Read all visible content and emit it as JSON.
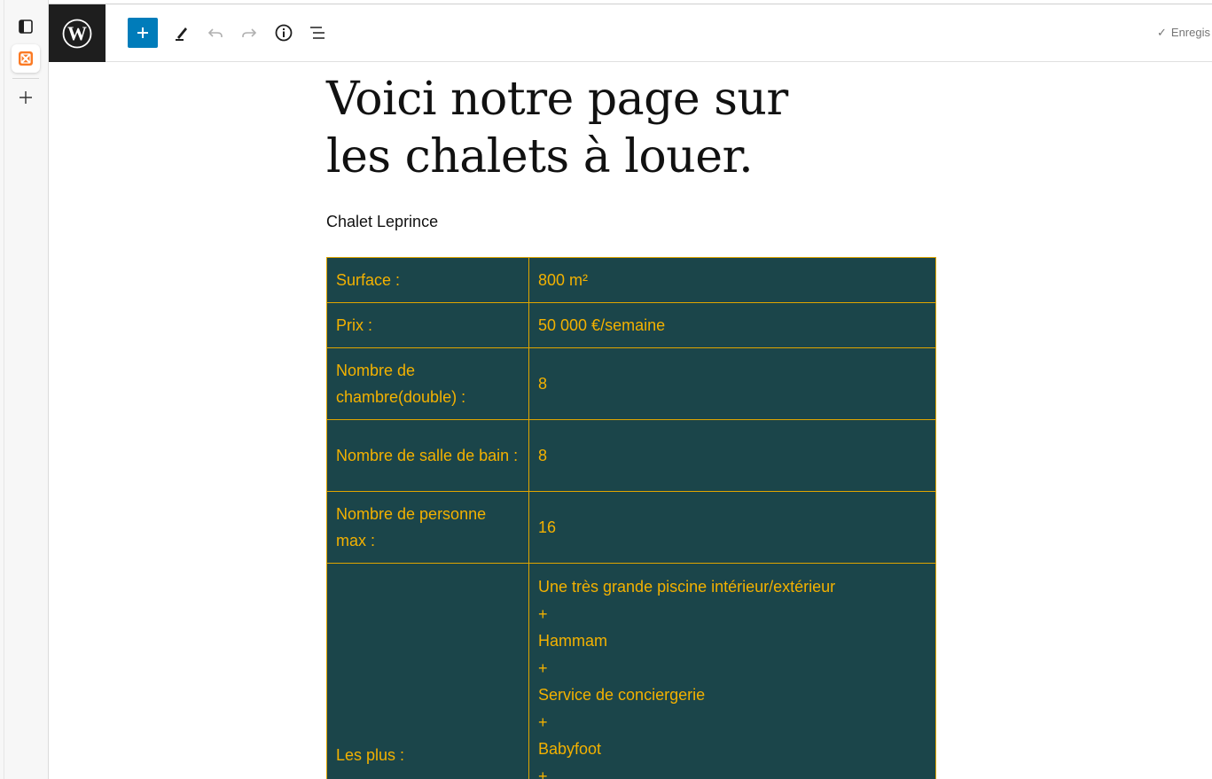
{
  "rail": {
    "icons": [
      "sidebar-toggle-icon",
      "xampp-icon",
      "plus-icon"
    ]
  },
  "toolbar": {
    "logo": "wordpress-logo",
    "tools": [
      "add-block-icon",
      "edit-pen-icon",
      "undo-icon",
      "redo-icon",
      "info-icon",
      "list-view-icon"
    ],
    "status_label": "Enregis"
  },
  "page": {
    "title": "Voici notre page sur les chalets à louer.",
    "subtitle": "Chalet Leprince"
  },
  "table": {
    "rows": [
      {
        "label": "Surface :",
        "value": "800 m²"
      },
      {
        "label": "Prix :",
        "value": "50 000 €/semaine"
      },
      {
        "label": "Nombre de chambre(double) :",
        "value": "8"
      },
      {
        "label": "Nombre de salle de bain :",
        "value": "8"
      },
      {
        "label": "Nombre de personne max :",
        "value": "16"
      }
    ],
    "extras": {
      "label": "Les plus :",
      "items": [
        "Une très grande piscine intérieur/extérieur",
        "+",
        "Hammam",
        "+",
        "Service de conciergerie",
        "+",
        "Babyfoot",
        "+"
      ]
    }
  },
  "colors": {
    "table_bg": "#1b454a",
    "table_text": "#f3b100",
    "accent": "#007cba",
    "logo_bg": "#1e1e1e"
  }
}
